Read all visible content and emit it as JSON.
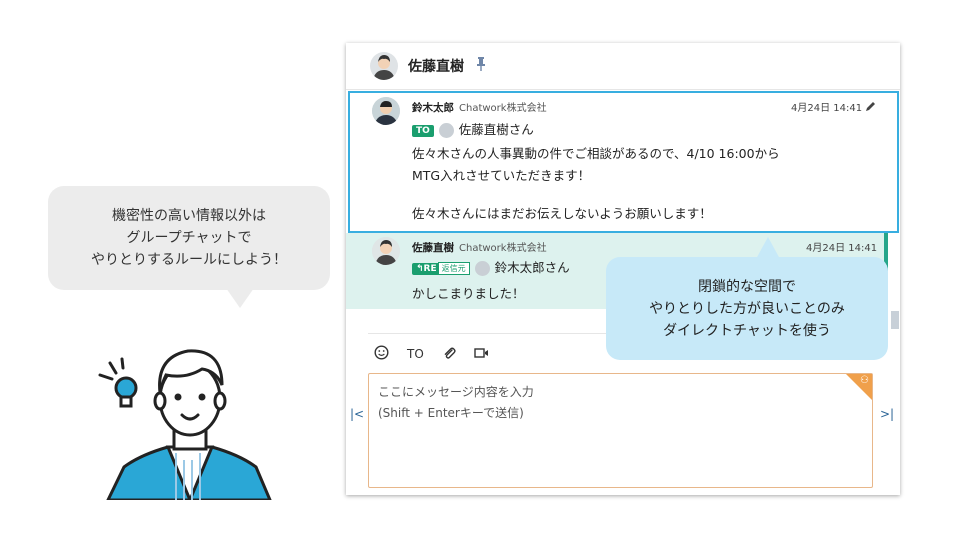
{
  "left_note": {
    "lines": [
      "機密性の高い情報以外は",
      "グループチャットで",
      "やりとりするルールにしよう！"
    ]
  },
  "right_note": {
    "lines": [
      "閉鎖的な空間で",
      "やりとりした方が良いことのみ",
      "ダイレクトチャットを使う"
    ]
  },
  "chat": {
    "room_title": "佐藤直樹",
    "pin_icon": "pin-icon",
    "messages": [
      {
        "sender": "鈴木太郎",
        "org": "Chatwork株式会社",
        "time": "4月24日 14:41",
        "to_label": "TO",
        "to_name": "佐藤直樹さん",
        "body": [
          "佐々木さんの人事異動の件でご相談があるので、4/10 16:00から",
          "MTG入れさせていただきます！",
          "",
          "佐々木さんにはまだお伝えしないようお願いします！"
        ]
      },
      {
        "sender": "佐藤直樹",
        "org": "Chatwork株式会社",
        "time": "4月24日 14:41",
        "re_label": "RE",
        "re_sub": "返信元",
        "re_name": "鈴木太郎さん",
        "body": [
          "かしこまりました！"
        ]
      }
    ],
    "toolbar": {
      "emoji_icon": "smile-icon",
      "to_label": "TO",
      "attach_icon": "paperclip-icon",
      "video_icon": "video-icon"
    },
    "input": {
      "placeholder_line1": "ここにメッセージ内容を入力",
      "placeholder_line2": "(Shift + Enterキーで送信)"
    },
    "nav_left": "|<",
    "nav_right": ">|"
  },
  "colors": {
    "highlight": "#38aee0",
    "reply_bg": "#ddf2ee",
    "accent_green": "#1a9e6e",
    "note_bubble": "#c7e9f8"
  }
}
